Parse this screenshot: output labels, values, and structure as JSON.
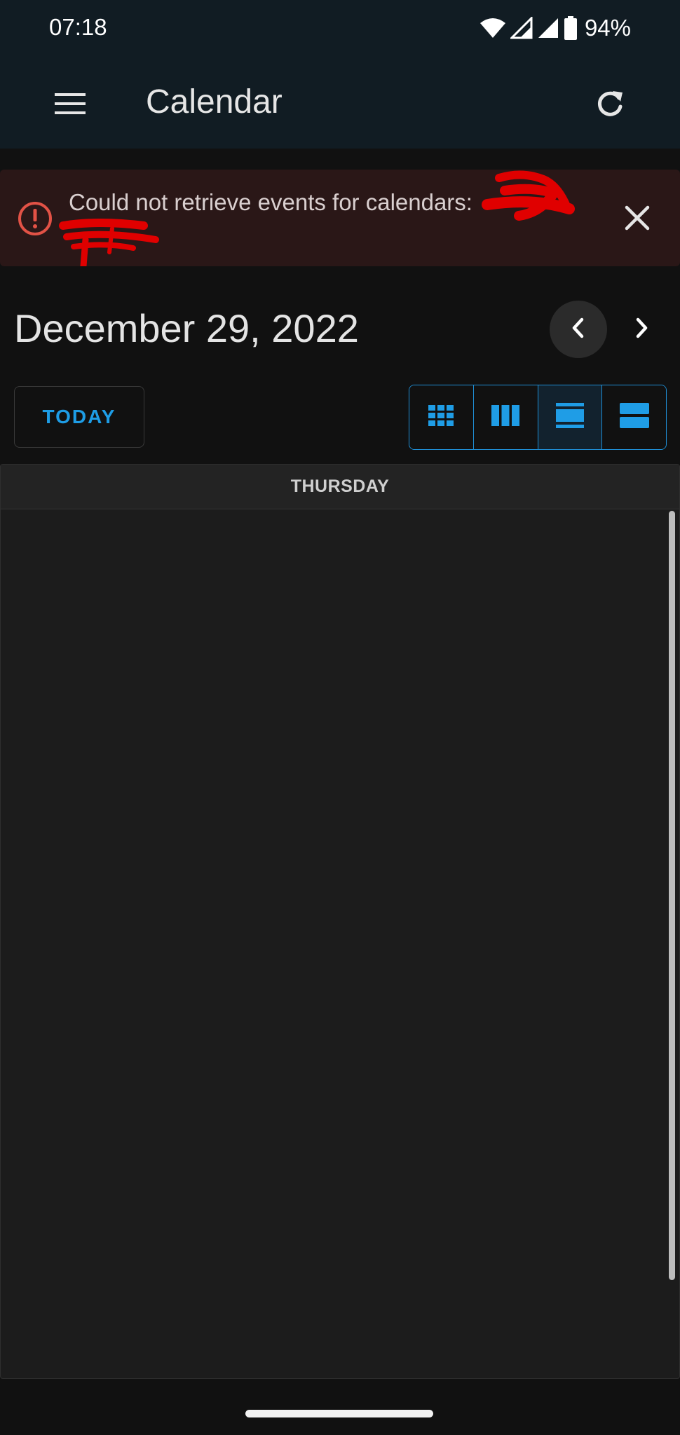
{
  "status_bar": {
    "time": "07:18",
    "battery_percent": "94%",
    "icons": [
      "wifi-icon",
      "signal-icon",
      "signal-icon",
      "battery-icon"
    ]
  },
  "app_bar": {
    "title": "Calendar",
    "menu_icon": "menu-icon",
    "refresh_icon": "refresh-icon"
  },
  "alert": {
    "message": "Could not retrieve events for calendars:",
    "icon": "alert-circle-icon",
    "close_icon": "close-icon",
    "color": "#e25246"
  },
  "calendar": {
    "date_heading": "December 29, 2022",
    "today_label": "TODAY",
    "day_header": "THURSDAY",
    "views": [
      {
        "icon": "month-grid-icon",
        "active": false
      },
      {
        "icon": "week-columns-icon",
        "active": false
      },
      {
        "icon": "day-list-icon",
        "active": true
      },
      {
        "icon": "list-rows-icon",
        "active": false
      }
    ]
  },
  "colors": {
    "accent": "#1f9de6",
    "header_bg": "#111c23",
    "alert_bg": "#2a1717",
    "redaction": "#e00000"
  }
}
